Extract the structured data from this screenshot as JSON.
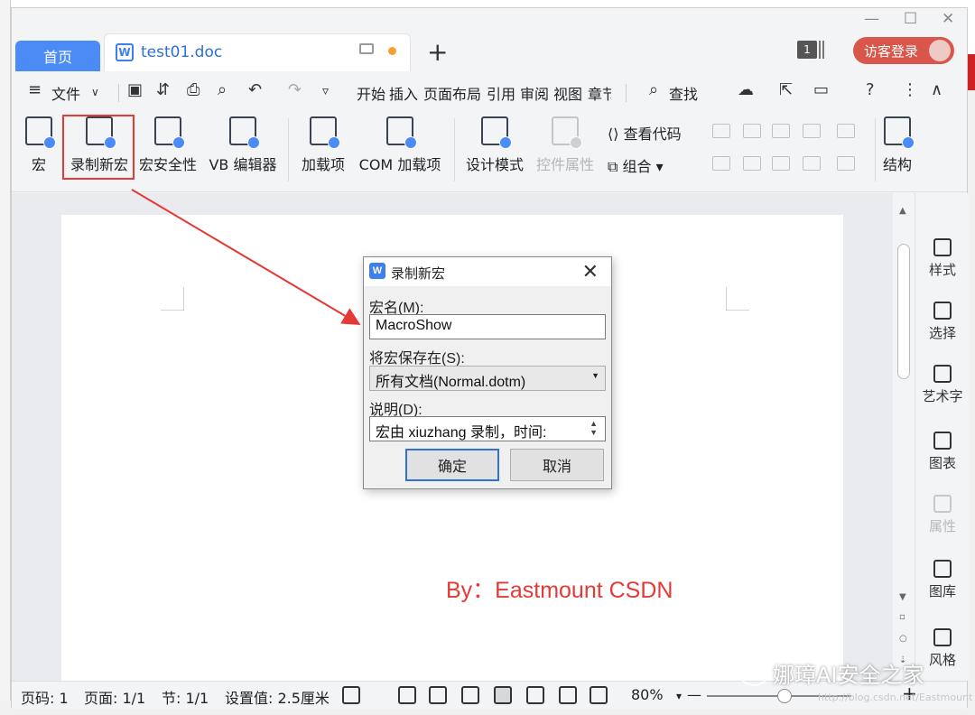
{
  "window": {
    "controls": [
      "—",
      "☐",
      "✕"
    ]
  },
  "tabs": {
    "home": "首页",
    "doc": "test01.doc",
    "add": "+"
  },
  "header": {
    "badge": "1",
    "login": "访客登录"
  },
  "menu": {
    "file": "文件",
    "items": [
      "开始",
      "插入",
      "页面布局",
      "引用",
      "审阅",
      "视图",
      "章节"
    ],
    "search": "查找"
  },
  "ribbon": {
    "macro": "宏",
    "record": "录制新宏",
    "security": "宏安全性",
    "vb_editor": "VB 编辑器",
    "addins": "加载项",
    "com_addins": "COM 加载项",
    "design_mode": "设计模式",
    "control_props": "控件属性",
    "view_code": "查看代码",
    "group": "组合",
    "structure": "结构"
  },
  "document": {
    "byline": "By：Eastmount CSDN"
  },
  "sidepanel": {
    "items": [
      "样式",
      "选择",
      "艺术字",
      "图表",
      "属性",
      "图库",
      "风格"
    ]
  },
  "statusbar": {
    "page_no": "页码: 1",
    "pages": "页面: 1/1",
    "section": "节: 1/1",
    "setting": "设置值: 2.5厘米",
    "zoom": "80%",
    "minus": "—",
    "plus": "+"
  },
  "dialog": {
    "title": "录制新宏",
    "name_label": "宏名(M):",
    "name_value": "MacroShow",
    "save_label": "将宏保存在(S):",
    "save_value": "所有文档(Normal.dotm)",
    "desc_label": "说明(D):",
    "desc_value": "宏由 xiuzhang 录制，时间:",
    "ok": "确定",
    "cancel": "取消"
  },
  "watermark": {
    "text": "娜璋AI安全之家",
    "url": "http://blog.csdn.net/Eastmount"
  },
  "colors": {
    "accent": "#4b8bf5",
    "highlight": "#e53935",
    "login": "#d9574a"
  }
}
